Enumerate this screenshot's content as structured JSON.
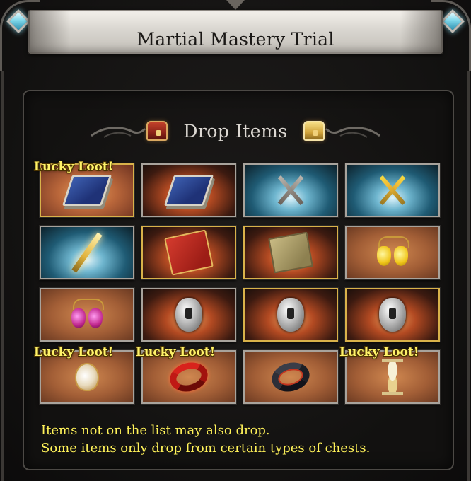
{
  "window": {
    "title": "Martial Mastery Trial"
  },
  "drop_section": {
    "title": "Drop Items",
    "chest_icons": [
      "red-chest-icon",
      "gold-chest-icon"
    ]
  },
  "items": [
    {
      "icon": "skill-book-icon",
      "bg": "orange",
      "lucky": true
    },
    {
      "icon": "skill-book-icon",
      "bg": "ember",
      "lucky": false
    },
    {
      "icon": "crossed-axes-icon",
      "bg": "blue",
      "lucky": false
    },
    {
      "icon": "crossed-blades-icon",
      "bg": "blue",
      "lucky": false
    },
    {
      "icon": "golden-sword-icon",
      "bg": "blue",
      "lucky": false
    },
    {
      "icon": "red-scroll-icon",
      "bg": "ember",
      "lucky": false
    },
    {
      "icon": "tan-scroll-icon",
      "bg": "ember",
      "lucky": false
    },
    {
      "icon": "yellow-earrings-icon",
      "bg": "tan",
      "lucky": false
    },
    {
      "icon": "pink-earrings-icon",
      "bg": "tan",
      "lucky": false
    },
    {
      "icon": "silver-mask-icon",
      "bg": "ember",
      "lucky": false
    },
    {
      "icon": "silver-mask-icon",
      "bg": "ember",
      "lucky": false
    },
    {
      "icon": "silver-mask-icon",
      "bg": "ember",
      "lucky": false
    },
    {
      "icon": "potion-vial-icon",
      "bg": "tan",
      "lucky": true
    },
    {
      "icon": "red-ring-icon",
      "bg": "tan",
      "lucky": true
    },
    {
      "icon": "dark-ring-icon",
      "bg": "tan",
      "lucky": false
    },
    {
      "icon": "hourglass-icon",
      "bg": "tan",
      "lucky": true
    }
  ],
  "lucky_label": "Lucky Loot!",
  "notes": {
    "line1": "Items not on the list may also drop.",
    "line2": "Some items only drop from certain types of chests."
  },
  "colors": {
    "lucky_text": "#fff36a",
    "note_text": "#fff259",
    "cell_border": "#a8a39c",
    "gold_border": "#d8b24a"
  }
}
